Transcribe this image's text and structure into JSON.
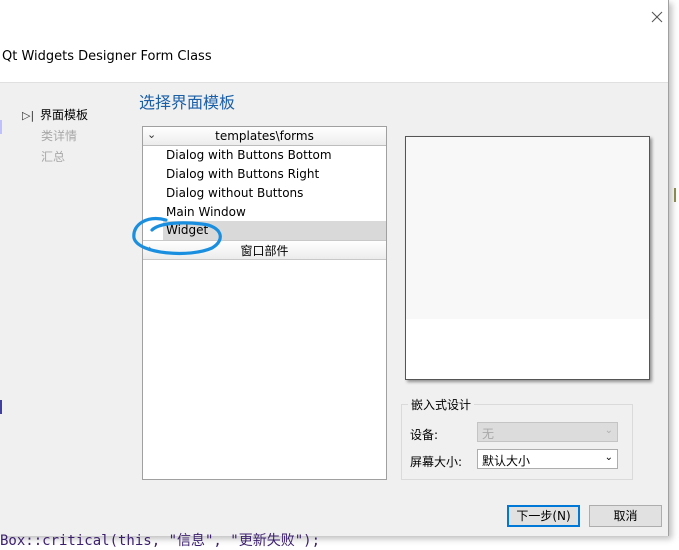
{
  "window": {
    "title": "Qt Widgets Designer Form Class"
  },
  "steps": [
    {
      "label": "界面模板",
      "state": "active"
    },
    {
      "label": "类详情",
      "state": "inactive"
    },
    {
      "label": "汇总",
      "state": "inactive"
    }
  ],
  "page": {
    "heading": "选择界面模板"
  },
  "templates": {
    "header": "templates\\forms",
    "items": [
      "Dialog with Buttons Bottom",
      "Dialog with Buttons Right",
      "Dialog without Buttons",
      "Main Window",
      "Widget"
    ],
    "selected": "Widget",
    "group": "窗口部件"
  },
  "embedded": {
    "title": "嵌入式设计",
    "device_label": "设备:",
    "device_value": "无",
    "screen_label": "屏幕大小:",
    "screen_value": "默认大小"
  },
  "buttons": {
    "next": "下一步(N)",
    "cancel": "取消"
  },
  "background_code": "Box::critical(this, \"信息\", \"更新失败\");",
  "colors": {
    "heading": "#1a5fa8",
    "annotation": "#1a8fe0",
    "default_button_border": "#0078d7"
  }
}
